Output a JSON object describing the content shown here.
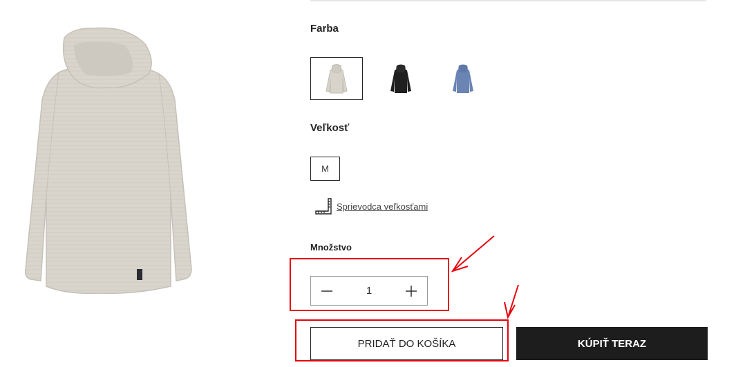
{
  "product": {
    "image_alt": "long-sleeve hoodie, beige",
    "colors": [
      {
        "name": "beige",
        "hex": "#d8d4cb",
        "selected": true
      },
      {
        "name": "black",
        "hex": "#1f1f1f",
        "selected": false
      },
      {
        "name": "blue",
        "hex": "#6a84b3",
        "selected": false
      }
    ]
  },
  "color_section": {
    "heading": "Farba"
  },
  "size_section": {
    "heading": "Veľkosť",
    "sizes": [
      "M"
    ],
    "guide_label": "Sprievodca veľkosťami"
  },
  "quantity_section": {
    "heading": "Množstvo",
    "value": "1",
    "decrement_symbol": "−",
    "increment_symbol": "+"
  },
  "actions": {
    "add_to_cart_label": "PRIDAŤ DO KOŠÍKA",
    "buy_now_label": "KÚPIŤ TERAZ"
  },
  "annotations": {
    "highlight_color": "#e8000b",
    "targets": [
      "quantity-stepper",
      "add-to-cart-button"
    ]
  }
}
